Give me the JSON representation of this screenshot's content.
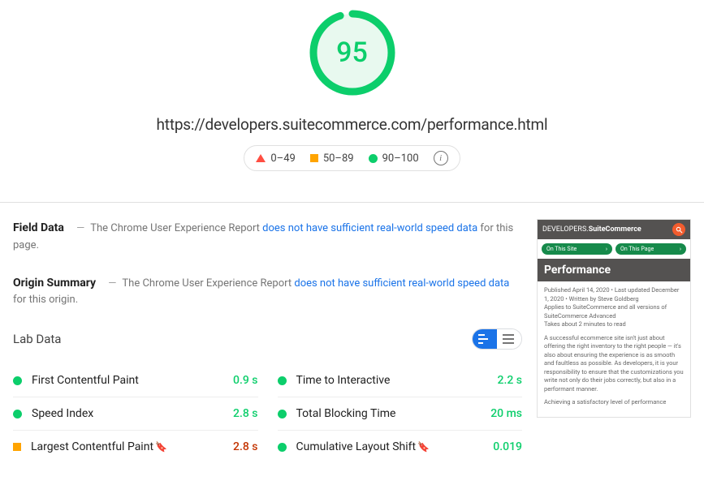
{
  "score": "95",
  "url": "https://developers.suitecommerce.com/performance.html",
  "legend": {
    "poor": "0–49",
    "avg": "50–89",
    "good": "90–100"
  },
  "field_data": {
    "title": "Field Data",
    "prefix": "The Chrome User Experience Report ",
    "link": "does not have sufficient real-world speed data",
    "suffix": " for this page."
  },
  "origin_summary": {
    "title": "Origin Summary",
    "prefix": "The Chrome User Experience Report ",
    "link": "does not have sufficient real-world speed data",
    "suffix": " for this origin."
  },
  "lab_data": {
    "title": "Lab Data",
    "metrics_left": [
      {
        "name": "First Contentful Paint",
        "value": "0.9 s",
        "status": "green",
        "flag": false
      },
      {
        "name": "Speed Index",
        "value": "2.8 s",
        "status": "green",
        "flag": false
      },
      {
        "name": "Largest Contentful Paint",
        "value": "2.8 s",
        "status": "orange",
        "flag": true
      }
    ],
    "metrics_right": [
      {
        "name": "Time to Interactive",
        "value": "2.2 s",
        "status": "green",
        "flag": false
      },
      {
        "name": "Total Blocking Time",
        "value": "20 ms",
        "status": "green",
        "flag": false
      },
      {
        "name": "Cumulative Layout Shift",
        "value": "0.019",
        "status": "green",
        "flag": true
      }
    ]
  },
  "preview": {
    "logo_light": "DEVELOPERS.",
    "logo_bold": "SuiteCommerce",
    "pill1": "On This Site",
    "pill2": "On This Page",
    "title": "Performance",
    "meta1": "Published April 14, 2020 • Last updated December 1, 2020 • Written by Steve Goldberg",
    "meta2": "Applies to SuiteCommerce and all versions of SuiteCommerce Advanced",
    "meta3": "Takes about 2 minutes to read",
    "para1": "A successful ecommerce site isn't just about offering the right inventory to the right people — it's also about ensuring the experience is as smooth and faultless as possible. As developers, it is your responsibility to ensure that the customizations you write not only do their jobs correctly, but also in a performant manner.",
    "para2": "Achieving a satisfactory level of performance"
  }
}
